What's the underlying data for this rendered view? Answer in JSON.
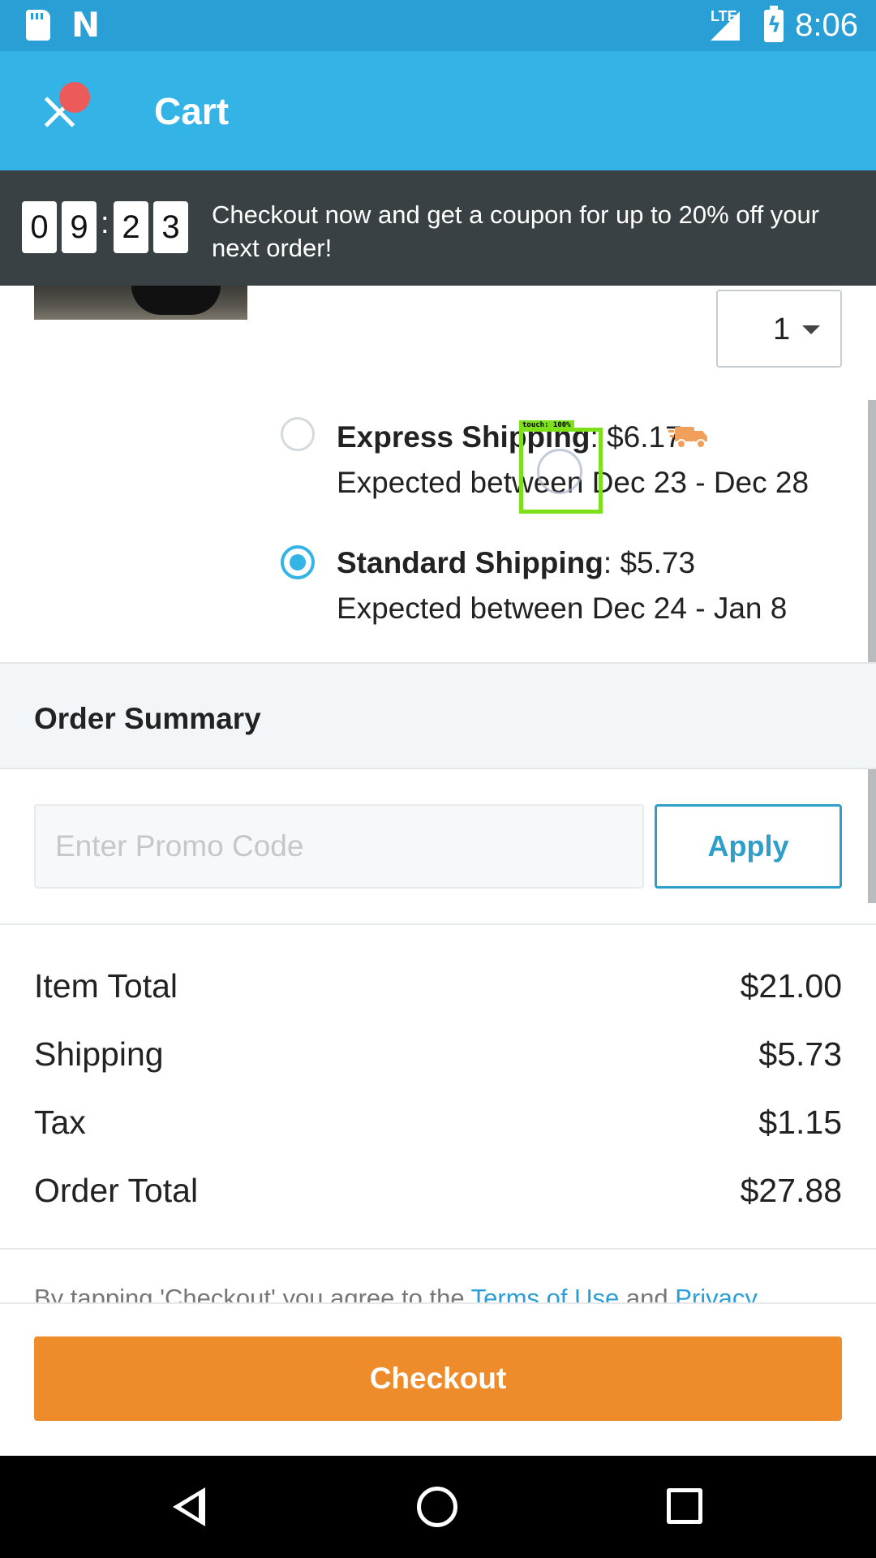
{
  "status_bar": {
    "network": "LTE",
    "time": "8:06",
    "notification_icons": [
      "sd-card-icon",
      "n-logo-icon"
    ]
  },
  "app_bar": {
    "title": "Cart",
    "close_icon": "close-icon"
  },
  "banner": {
    "countdown_digits": [
      "0",
      "9",
      "2",
      "3"
    ],
    "separator": ":",
    "message": "Checkout now and get a coupon for up to 20% off your next order!"
  },
  "item": {
    "quantity": "1"
  },
  "shipping": {
    "options": [
      {
        "name": "Express Shipping",
        "price": ": $6.17",
        "expected": "Expected between Dec 23 - Dec 28",
        "selected": false,
        "icon": "truck-icon"
      },
      {
        "name": "Standard Shipping",
        "price": ": $5.73",
        "expected": "Expected between Dec 24 - Jan 8",
        "selected": true
      }
    ]
  },
  "touch_overlay": {
    "label": "touch: 100%"
  },
  "summary": {
    "title": "Order Summary",
    "promo_placeholder": "Enter Promo Code",
    "apply_label": "Apply",
    "rows": [
      {
        "label": "Item Total",
        "amount": "$21.00"
      },
      {
        "label": "Shipping",
        "amount": "$5.73"
      },
      {
        "label": "Tax",
        "amount": "$1.15"
      },
      {
        "label": "Order Total",
        "amount": "$27.88"
      }
    ]
  },
  "terms": {
    "prefix": "By tapping 'Checkout' you agree to the ",
    "terms_link": "Terms of Use",
    "middle": " and ",
    "privacy_link": "Privacy"
  },
  "checkout": {
    "label": "Checkout"
  },
  "colors": {
    "primary": "#33b3e6",
    "status_bar": "#2a9fd6",
    "banner": "#3a4144",
    "checkout": "#ee8c2c",
    "accent_link": "#2a9fd6"
  }
}
